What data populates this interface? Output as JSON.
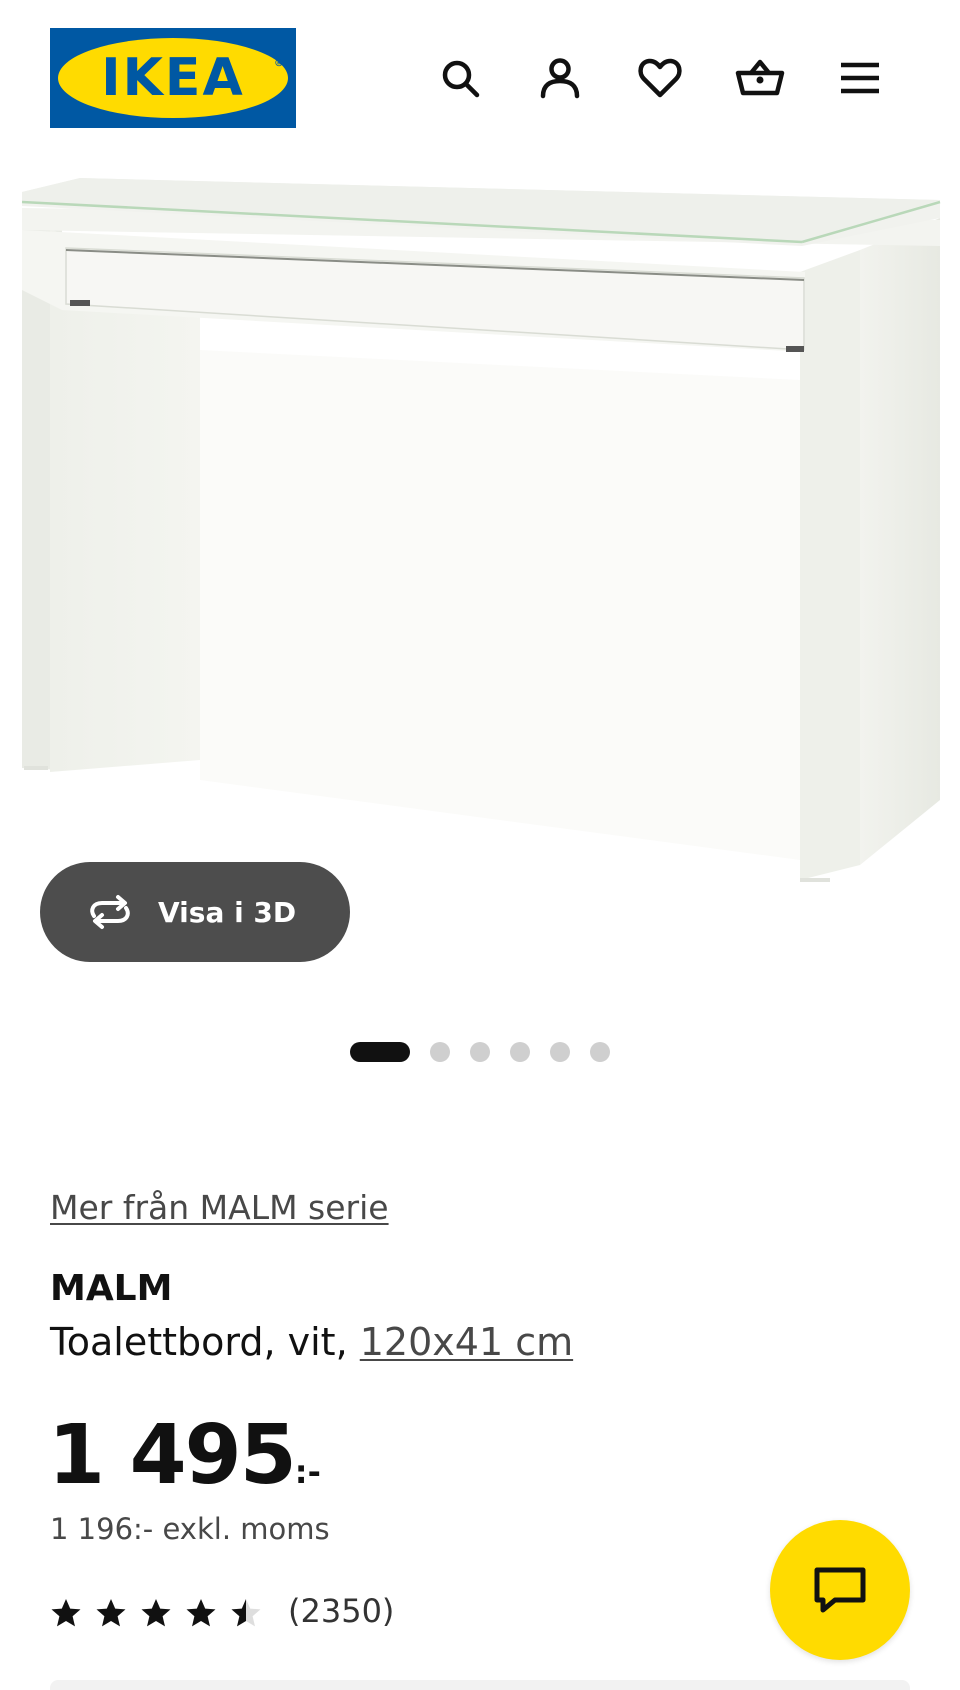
{
  "brand": {
    "logo_text": "IKEA",
    "logo_mark": "®",
    "blue": "#0058a3",
    "yellow": "#ffdb00"
  },
  "header": {
    "icons": [
      "search-icon",
      "user-icon",
      "heart-icon",
      "basket-icon",
      "menu-icon"
    ]
  },
  "gallery": {
    "view_3d_label": "Visa i 3D",
    "slide_count": 6,
    "active_slide": 1
  },
  "product": {
    "series_link": "Mer från MALM serie",
    "name": "MALM",
    "description_prefix": "Toalettbord, vit,",
    "size_link": "120x41 cm",
    "price_main": "1 495",
    "price_suffix": ":-",
    "price_ex_vat": "1 196:- exkl. moms",
    "rating": 4.5,
    "rating_max": 5,
    "review_count": "(2350)"
  },
  "chat": {
    "icon": "chat-icon"
  }
}
